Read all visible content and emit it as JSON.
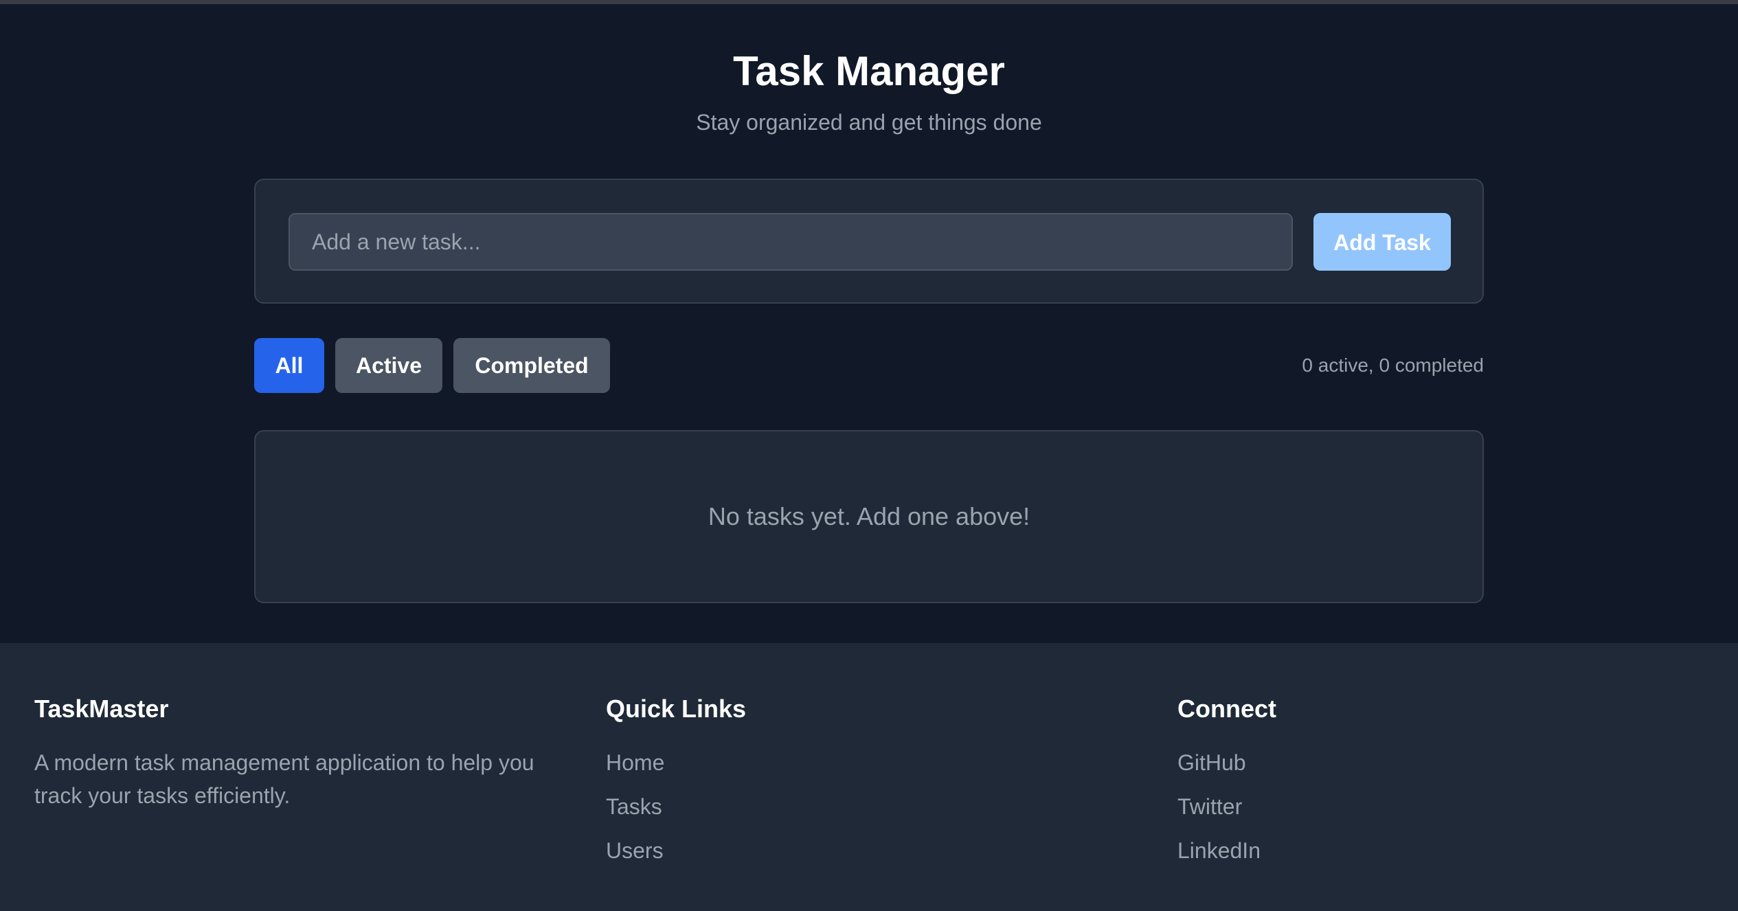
{
  "header": {
    "title": "Task Manager",
    "subtitle": "Stay organized and get things done"
  },
  "add_task": {
    "placeholder": "Add a new task...",
    "value": "",
    "button_label": "Add Task"
  },
  "filters": {
    "items": [
      {
        "label": "All",
        "selected": true
      },
      {
        "label": "Active",
        "selected": false
      },
      {
        "label": "Completed",
        "selected": false
      }
    ],
    "counts_text": "0 active, 0 completed"
  },
  "tasks": {
    "empty_message": "No tasks yet. Add one above!",
    "items": []
  },
  "footer": {
    "brand": {
      "title": "TaskMaster",
      "description": "A modern task management application to help you track your tasks efficiently."
    },
    "quick_links": {
      "title": "Quick Links",
      "items": [
        "Home",
        "Tasks",
        "Users"
      ]
    },
    "connect": {
      "title": "Connect",
      "items": [
        "GitHub",
        "Twitter",
        "LinkedIn"
      ]
    }
  },
  "colors": {
    "background": "#111827",
    "card": "#1f2937",
    "accent": "#2563eb",
    "add_button": "#93c5fd",
    "filter_inactive": "#4b5563"
  }
}
